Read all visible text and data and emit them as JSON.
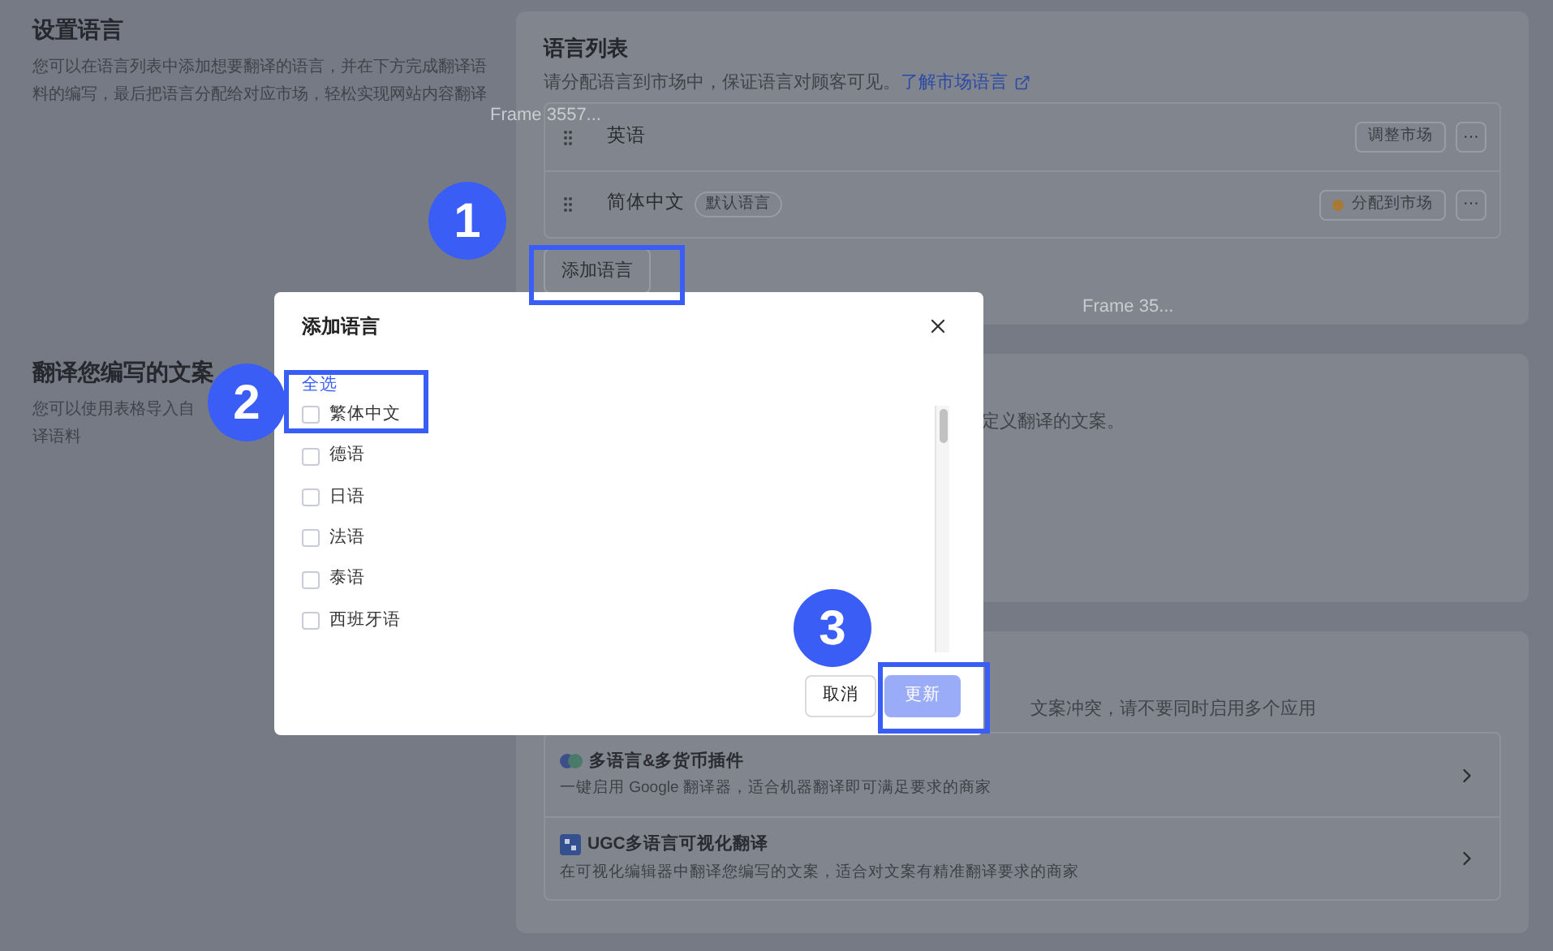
{
  "left_sections": [
    {
      "title": "设置语言",
      "lines": [
        "您可以在语言列表中添加想要翻译的语言，并在下方完成翻译语",
        "料的编写，最后把语言分配给对应市场，轻松实现网站内容翻译"
      ]
    },
    {
      "title": "翻译您编写的文案",
      "lines": [
        "您可以使用表格导入自",
        "译语料"
      ]
    }
  ],
  "language_card": {
    "title": "语言列表",
    "description": "请分配语言到市场中，保证语言对顾客可见。",
    "link": "了解市场语言",
    "rows": [
      {
        "name": "英语",
        "badge": null,
        "action": "调整市场",
        "warning": false,
        "more": "···"
      },
      {
        "name": "简体中文",
        "badge": "默认语言",
        "action": "分配到市场",
        "warning": true,
        "more": "···"
      }
    ],
    "add_button": "添加语言"
  },
  "frame_labels": [
    "Frame 3557...",
    "Frame 35..."
  ],
  "custom_card": {
    "description": "定义翻译的文案。"
  },
  "apps_card": {
    "description": "文案冲突，请不要同时启用多个应用",
    "apps": [
      {
        "kind": "plugin",
        "name": "多语言&多货币插件",
        "description": "一键启用 Google 翻译器，适合机器翻译即可满足要求的商家"
      },
      {
        "kind": "visual",
        "name": "UGC多语言可视化翻译",
        "description": "在可视化编辑器中翻译您编写的文案，适合对文案有精准翻译要求的商家"
      }
    ]
  },
  "dialog": {
    "title": "添加语言",
    "select_all": "全选",
    "options": [
      {
        "label": "繁体中文",
        "checked": false
      },
      {
        "label": "德语",
        "checked": false
      },
      {
        "label": "日语",
        "checked": false
      },
      {
        "label": "法语",
        "checked": false
      },
      {
        "label": "泰语",
        "checked": false
      },
      {
        "label": "西班牙语",
        "checked": false
      }
    ],
    "cancel": "取消",
    "confirm": {
      "label": "更新",
      "disabled": true
    }
  },
  "annotations": [
    "1",
    "2",
    "3"
  ]
}
